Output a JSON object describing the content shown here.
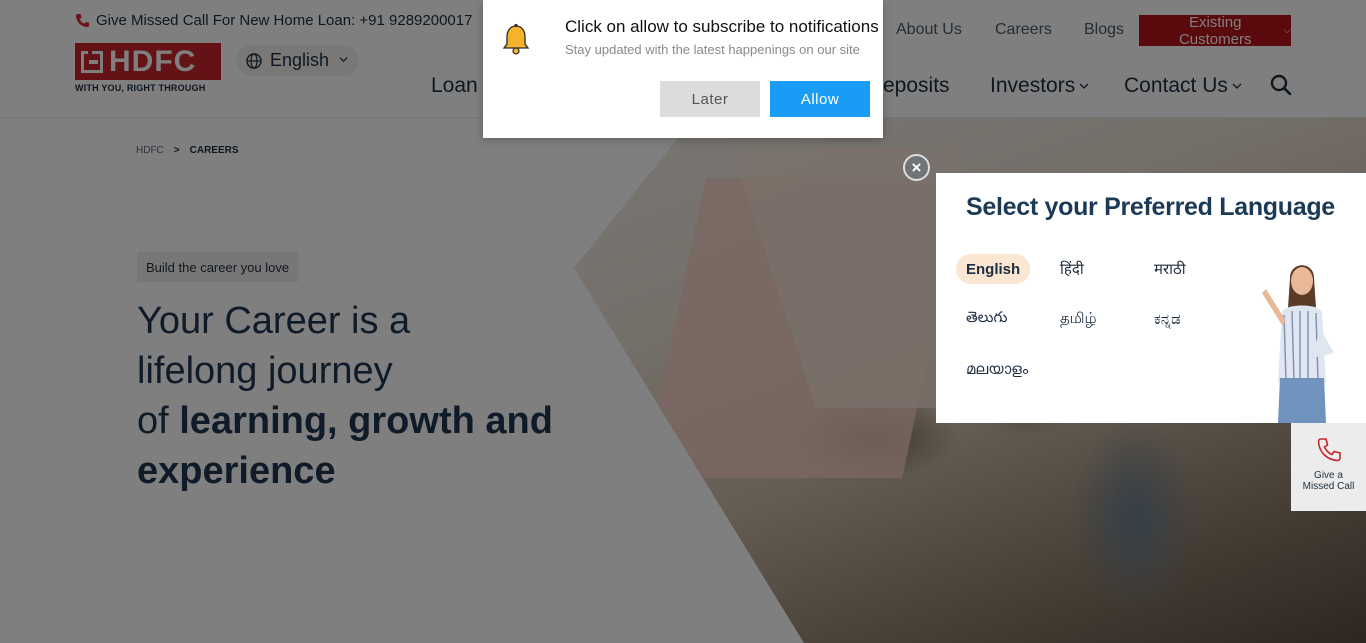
{
  "header": {
    "missed_call_text": "Give Missed Call For New Home Loan: +91 9289200017",
    "logo_text": "HDFC",
    "logo_tagline": "WITH YOU, RIGHT THROUGH",
    "language_selected": "English",
    "top_links": [
      "About Us",
      "Careers",
      "Blogs"
    ],
    "existing_customers": "Existing Customers",
    "nav": {
      "loan": "Loan P",
      "deposits": "eposits",
      "investors": "Investors",
      "contact": "Contact Us"
    }
  },
  "breadcrumb": {
    "home": "HDFC",
    "current": "CAREERS"
  },
  "hero": {
    "pill": "Build the career you love",
    "title_line1": "Your Career is a",
    "title_line2": "lifelong journey",
    "title_line3_prefix": "of ",
    "title_line3_bold": "learning, growth and",
    "title_line4_bold": "experience"
  },
  "notification": {
    "title": "Click on allow to subscribe to notifications",
    "subtitle": "Stay updated with the latest happenings on our site",
    "later": "Later",
    "allow": "Allow"
  },
  "language_modal": {
    "close": "×",
    "heading": "Select your Preferred Language",
    "options": [
      "English",
      "हिंदी",
      "मराठी",
      "తెలుగు",
      "தமிழ்",
      "ಕನ್ನಡ",
      "മലയാളം"
    ],
    "selected": "English"
  },
  "missed_call_widget": {
    "line1": "Give a",
    "line2": "Missed Call"
  },
  "colors": {
    "brand_red": "#c8242b",
    "existing_btn": "#b4141b",
    "allow_blue": "#1a9bf5",
    "navy": "#1c3a55"
  }
}
